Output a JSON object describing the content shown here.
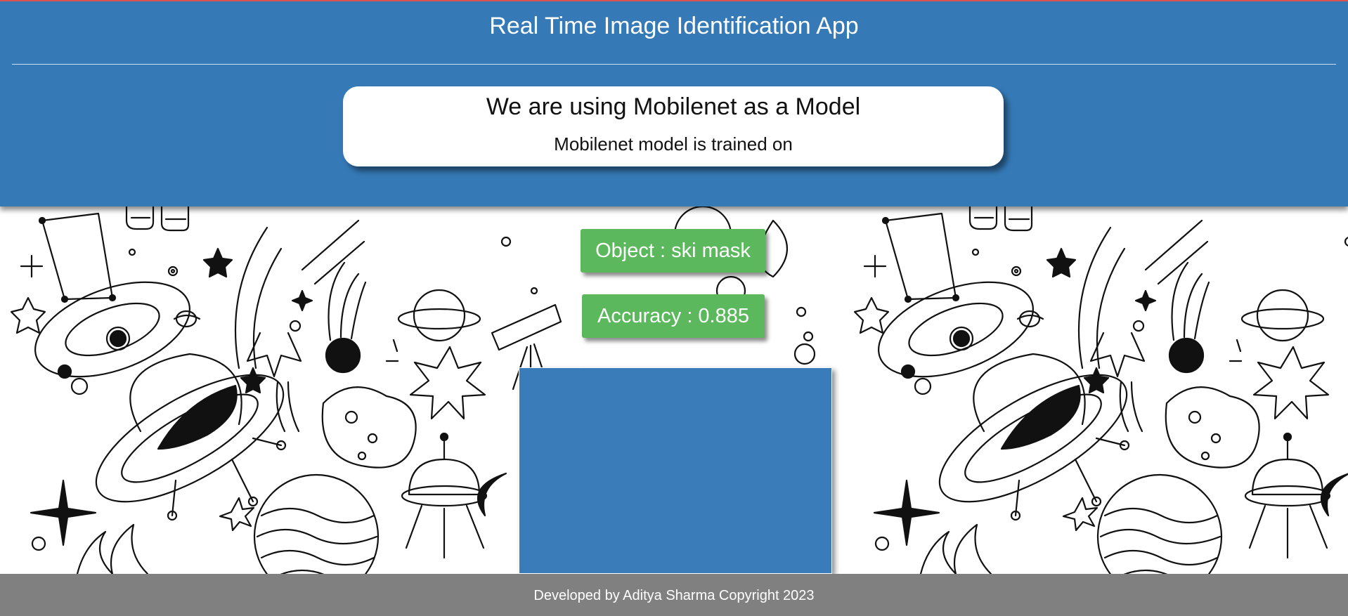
{
  "header": {
    "title": "Real Time Image Identification App",
    "background_color": "#357ab7"
  },
  "model_card": {
    "title": "We are using Mobilenet as a Model",
    "description": "Mobilenet model is trained on"
  },
  "prediction": {
    "object_text": "Object : ski mask",
    "accuracy_text": "Accuracy : 0.885",
    "badge_color": "#5cb85c"
  },
  "webcam": {
    "icon": "webcam-feed",
    "color": "#3a7cba"
  },
  "background": {
    "icon": "space-doodle-pattern"
  },
  "footer": {
    "text": "Developed by Aditya Sharma Copyright 2023",
    "background_color": "#808080"
  }
}
